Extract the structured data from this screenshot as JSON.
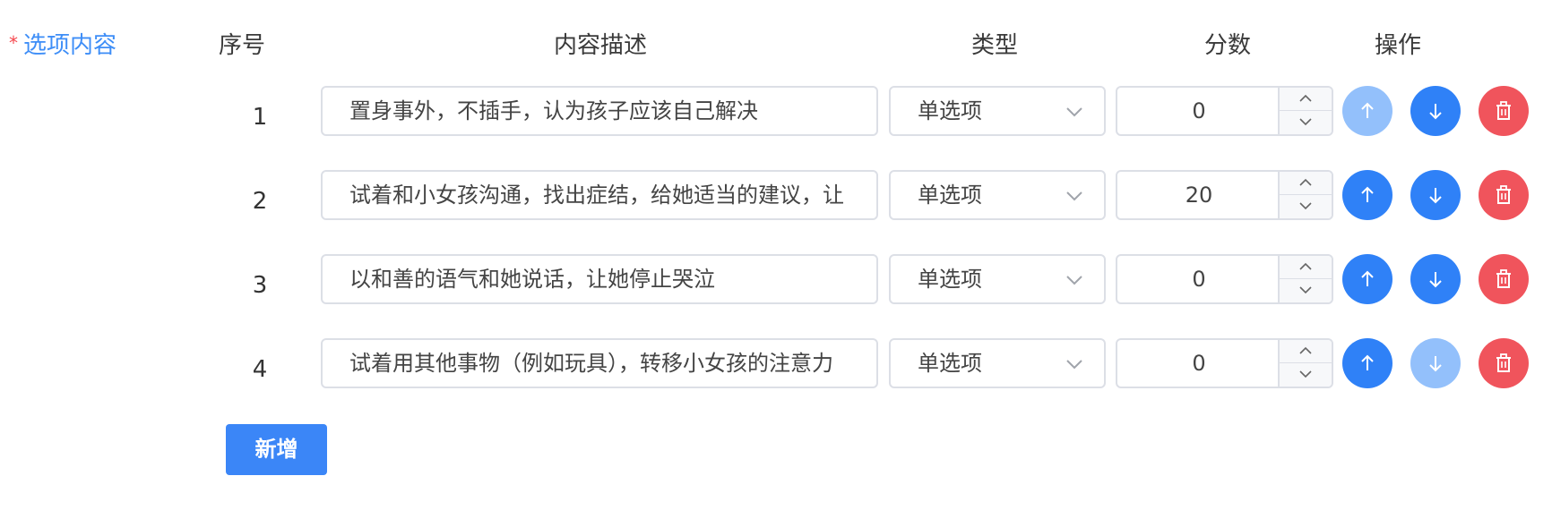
{
  "form": {
    "required_mark": "*",
    "label": "选项内容"
  },
  "headers": {
    "seq": "序号",
    "desc": "内容描述",
    "type": "类型",
    "score": "分数",
    "ops": "操作"
  },
  "rows": [
    {
      "seq": "1",
      "desc": "置身事外，不插手，认为孩子应该自己解决",
      "type": "单选项",
      "score": "0",
      "up_disabled": true,
      "down_disabled": false
    },
    {
      "seq": "2",
      "desc": "试着和小女孩沟通，找出症结，给她适当的建议，让",
      "type": "单选项",
      "score": "20",
      "up_disabled": false,
      "down_disabled": false
    },
    {
      "seq": "3",
      "desc": "以和善的语气和她说话，让她停止哭泣",
      "type": "单选项",
      "score": "0",
      "up_disabled": false,
      "down_disabled": false
    },
    {
      "seq": "4",
      "desc": "试着用其他事物（例如玩具），转移小女孩的注意力",
      "type": "单选项",
      "score": "0",
      "up_disabled": false,
      "down_disabled": true
    }
  ],
  "add_button": "新增",
  "colors": {
    "primary": "#2f81f7",
    "primary_disabled": "#93c0fb",
    "danger": "#f0545c",
    "label": "#3e8ef7"
  }
}
